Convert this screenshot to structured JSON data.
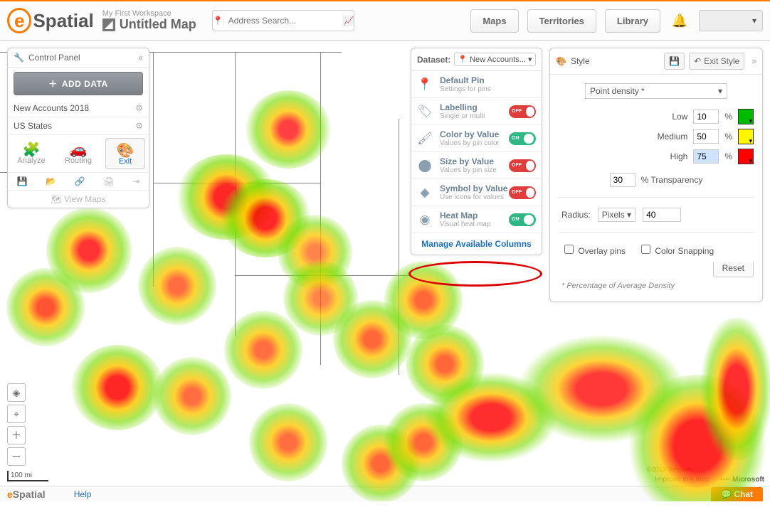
{
  "header": {
    "workspace_subtitle": "My First Workspace",
    "map_title": "Untitled Map",
    "search_placeholder": "Address Search...",
    "nav": {
      "maps": "Maps",
      "territories": "Territories",
      "library": "Library"
    }
  },
  "control_panel": {
    "title": "Control Panel",
    "add_data": "ADD DATA",
    "layers": [
      "New Accounts 2018",
      "US States"
    ],
    "tools": {
      "analyze": "Analyze",
      "routing": "Routing",
      "exit": "Exit"
    },
    "view_maps": "View Maps"
  },
  "dataset_panel": {
    "label": "Dataset:",
    "selected": "New Accounts...",
    "items": [
      {
        "title": "Default Pin",
        "sub": "Settings for pins",
        "toggle": null
      },
      {
        "title": "Labelling",
        "sub": "Single or multi",
        "toggle": "OFF"
      },
      {
        "title": "Color by Value",
        "sub": "Values by pin color",
        "toggle": "ON"
      },
      {
        "title": "Size by Value",
        "sub": "Values by pin size",
        "toggle": "OFF"
      },
      {
        "title": "Symbol by Value",
        "sub": "Use icons for values",
        "toggle": "OFF"
      },
      {
        "title": "Heat Map",
        "sub": "Visual heat map",
        "toggle": "ON"
      }
    ],
    "footer_link": "Manage Available Columns"
  },
  "style_panel": {
    "title": "Style",
    "exit": "Exit Style",
    "mode": "Point density *",
    "rows": {
      "low": {
        "label": "Low",
        "value": "10",
        "pct": "%"
      },
      "medium": {
        "label": "Medium",
        "value": "50",
        "pct": "%"
      },
      "high": {
        "label": "High",
        "value": "75",
        "pct": "%"
      }
    },
    "transparency": {
      "value": "30",
      "label": "% Transparency"
    },
    "radius": {
      "label": "Radius:",
      "unit": "Pixels",
      "value": "40"
    },
    "overlay_pins": "Overlay pins",
    "color_snapping": "Color Snapping",
    "reset": "Reset",
    "note": "* Percentage of Average Density"
  },
  "bottom": {
    "help": "Help",
    "chat": "Chat",
    "scale": "100 mi",
    "attribution": "Improve this map",
    "tomtom": "©2019 TomTom",
    "ms": "Microsoft"
  }
}
